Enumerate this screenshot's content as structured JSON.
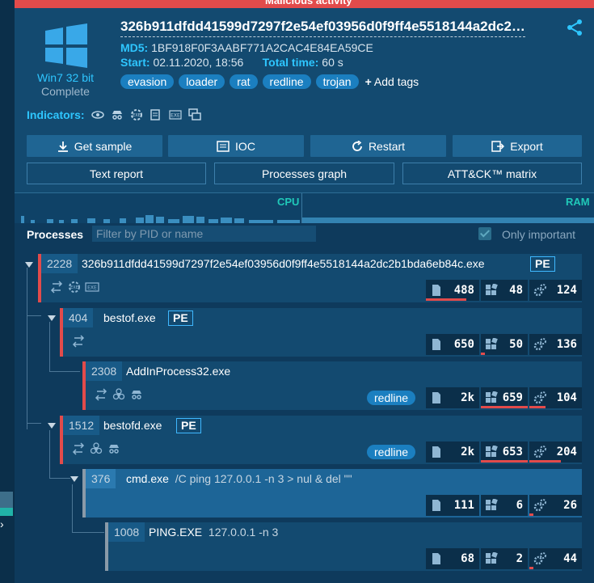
{
  "banner": "Malicious activity",
  "sample": {
    "title": "326b911dfdd41599d7297f2e54ef03956d0f9ff4e5518144a2dc2…",
    "md5_label": "MD5:",
    "md5": "1BF918F0F3AABF771A2CAC4E84EA59CE",
    "start_label": "Start:",
    "start": "02.11.2020, 18:56",
    "total_label": "Total time:",
    "total": "60 s",
    "os": "Win7 32 bit",
    "status": "Complete",
    "tags": [
      "evasion",
      "loader",
      "rat",
      "redline",
      "trojan"
    ],
    "add_tags": "Add tags"
  },
  "indicators_label": "Indicators:",
  "buttons": {
    "get_sample": "Get sample",
    "ioc": "IOC",
    "restart": "Restart",
    "export": "Export",
    "text_report": "Text report",
    "processes_graph": "Processes graph",
    "attck": "ATT&CK™ matrix"
  },
  "graph": {
    "cpu": "CPU",
    "ram": "RAM"
  },
  "processes": {
    "label": "Processes",
    "filter_placeholder": "Filter by PID or name",
    "only_important": "Only important"
  },
  "tree": [
    {
      "pid": "2228",
      "name": "326b911dfdd41599d7297f2e54ef03956d0f9ff4e5518144a2dc2b1bda6eb84c.exe",
      "args": "",
      "pe": "PE",
      "tag": "",
      "files": "488",
      "reg": "48",
      "mods": "124",
      "files_bar": 0.75,
      "reg_bar": 0,
      "mods_bar": 0
    },
    {
      "pid": "404",
      "name": "bestof.exe",
      "args": "",
      "pe": "PE",
      "tag": "",
      "files": "650",
      "reg": "50",
      "mods": "136",
      "files_bar": 0,
      "reg_bar": 0.08,
      "mods_bar": 0
    },
    {
      "pid": "2308",
      "name": "AddInProcess32.exe",
      "args": "",
      "pe": "",
      "tag": "redline",
      "files": "2k",
      "reg": "659",
      "mods": "104",
      "files_bar": 0,
      "reg_bar": 1.0,
      "mods_bar": 0.3
    },
    {
      "pid": "1512",
      "name": "bestofd.exe",
      "args": "",
      "pe": "PE",
      "tag": "redline",
      "files": "2k",
      "reg": "653",
      "mods": "204",
      "files_bar": 0,
      "reg_bar": 1.0,
      "mods_bar": 0.6
    },
    {
      "pid": "376",
      "name": "cmd.exe",
      "args": "/C ping 127.0.0.1 -n 3 > nul & del \"\"",
      "pe": "",
      "tag": "",
      "files": "111",
      "reg": "6",
      "mods": "26",
      "files_bar": 0,
      "reg_bar": 0,
      "mods_bar": 0.08
    },
    {
      "pid": "1008",
      "name": "PING.EXE",
      "args": "127.0.0.1 -n 3",
      "pe": "",
      "tag": "",
      "files": "68",
      "reg": "2",
      "mods": "44",
      "files_bar": 0,
      "reg_bar": 0,
      "mods_bar": 0.08
    }
  ],
  "colors": {
    "accent": "#2ec6ff",
    "danger": "#e24b4b",
    "tag": "#1b7fc0",
    "panel": "#134a70"
  }
}
